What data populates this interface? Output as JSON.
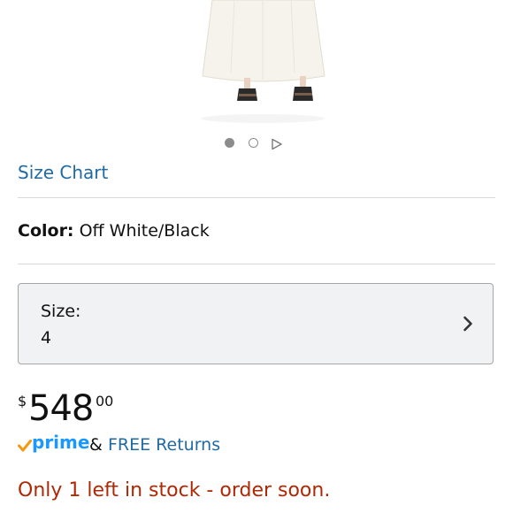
{
  "product": {
    "carousel": {
      "total_dots": 2,
      "active_index": 0,
      "has_video": true
    },
    "size_chart_link": "Size Chart",
    "color": {
      "label": "Color:",
      "value": "Off White/Black"
    },
    "size": {
      "label": "Size:",
      "value": "4"
    },
    "price": {
      "currency_symbol": "$",
      "whole": "548",
      "fraction": "00"
    },
    "shipping": {
      "prime_text": "prime",
      "ampersand": "&",
      "returns_link": "FREE Returns"
    },
    "stock_message": "Only 1 left in stock - order soon."
  },
  "colors": {
    "link": "#1f6aa5",
    "stock_warning": "#b12704",
    "prime_blue": "#1a98ff",
    "prime_check": "#f59a10"
  },
  "icons": {
    "size_selector": "chevron-right-icon",
    "carousel_video": "play-icon",
    "prime": "prime-check-icon"
  }
}
